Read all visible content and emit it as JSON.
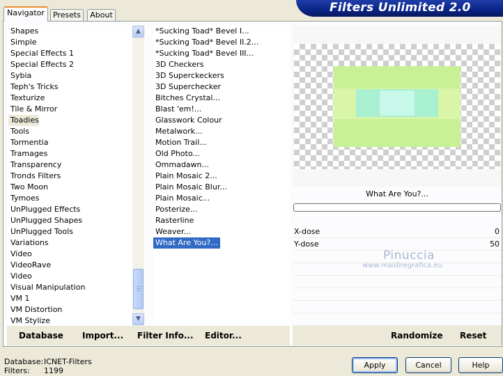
{
  "app": {
    "title": "Filters Unlimited 2.0"
  },
  "tabs": [
    "Navigator",
    "Presets",
    "About"
  ],
  "categories": {
    "items": [
      "Shapes",
      "Simple",
      "Special Effects 1",
      "Special Effects 2",
      "Sybia",
      "Teph's Tricks",
      "Texturize",
      "Tile & Mirror",
      "Toadies",
      "Tools",
      "Tormentia",
      "Tramages",
      "Transparency",
      "Tronds Filters",
      "Two Moon",
      "Tymoes",
      "UnPlugged Effects",
      "UnPlugged Shapes",
      "UnPlugged Tools",
      "Variations",
      "Video",
      "VideoRave",
      "Video",
      "Visual Manipulation",
      "VM 1",
      "VM Distortion",
      "VM Stylize"
    ],
    "selected": "Toadies"
  },
  "filters": {
    "items": [
      "*Sucking Toad*  Bevel I...",
      "*Sucking Toad*  Bevel II.2...",
      "*Sucking Toad*  Bevel III...",
      "3D Checkers",
      "3D Superckeckers",
      "3D Superchecker",
      "Bitches Crystal...",
      "Blast 'em!...",
      "Glasswork Colour",
      "Metalwork...",
      "Motion Trail...",
      "Old Photo...",
      "Ommadawn...",
      "Plain Mosaic 2...",
      "Plain Mosaic Blur...",
      "Plain Mosaic...",
      "Posterize...",
      "Rasterline",
      "Weaver...",
      "What Are You?..."
    ],
    "selected": "What Are You?..."
  },
  "preview": {
    "filter_name": "What Are You?...",
    "params": [
      {
        "label": "X-dose",
        "value": "0"
      },
      {
        "label": "Y-dose",
        "value": "50"
      }
    ],
    "watermark_name": "Pinuccia",
    "watermark_url": "www.maidiregrafica.eu"
  },
  "toolbar": {
    "database": "Database",
    "import": "Import...",
    "filter_info": "Filter Info...",
    "editor": "Editor...",
    "randomize": "Randomize",
    "reset": "Reset"
  },
  "footer": {
    "database_label": "Database:",
    "database_value": "ICNET-Filters",
    "filters_label": "Filters:",
    "filters_value": "1199",
    "apply": "Apply",
    "cancel": "Cancel",
    "help": "Help"
  },
  "colors": {
    "banner": "#0a2486",
    "highlight": "#316ac5",
    "panel": "#ece9d8"
  }
}
